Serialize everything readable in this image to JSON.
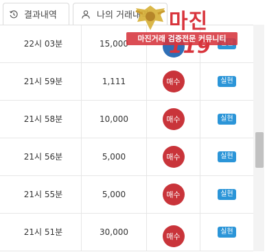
{
  "tabs": [
    {
      "label": "결과내역",
      "icon": "history-icon"
    },
    {
      "label": "나의 거래내역",
      "icon": "user-icon"
    }
  ],
  "watermark": {
    "brand": "마진",
    "brand_number": "119",
    "tagline": "마진거래 검증전문 커뮤니티"
  },
  "rows": [
    {
      "time": "22시 03분",
      "amount": "15,000",
      "side": "",
      "status": "실현"
    },
    {
      "time": "21시 59분",
      "amount": "1,111",
      "side": "매수",
      "status": "실현"
    },
    {
      "time": "21시 58분",
      "amount": "10,000",
      "side": "매수",
      "status": "실현"
    },
    {
      "time": "21시 56분",
      "amount": "5,000",
      "side": "매수",
      "status": "실현"
    },
    {
      "time": "21시 55분",
      "amount": "5,000",
      "side": "매수",
      "status": "실현"
    },
    {
      "time": "21시 51분",
      "amount": "30,000",
      "side": "매수",
      "status": "실현"
    }
  ],
  "colors": {
    "buy": "#c9343a",
    "badge": "#2b95d8",
    "brand": "#d8343c"
  }
}
